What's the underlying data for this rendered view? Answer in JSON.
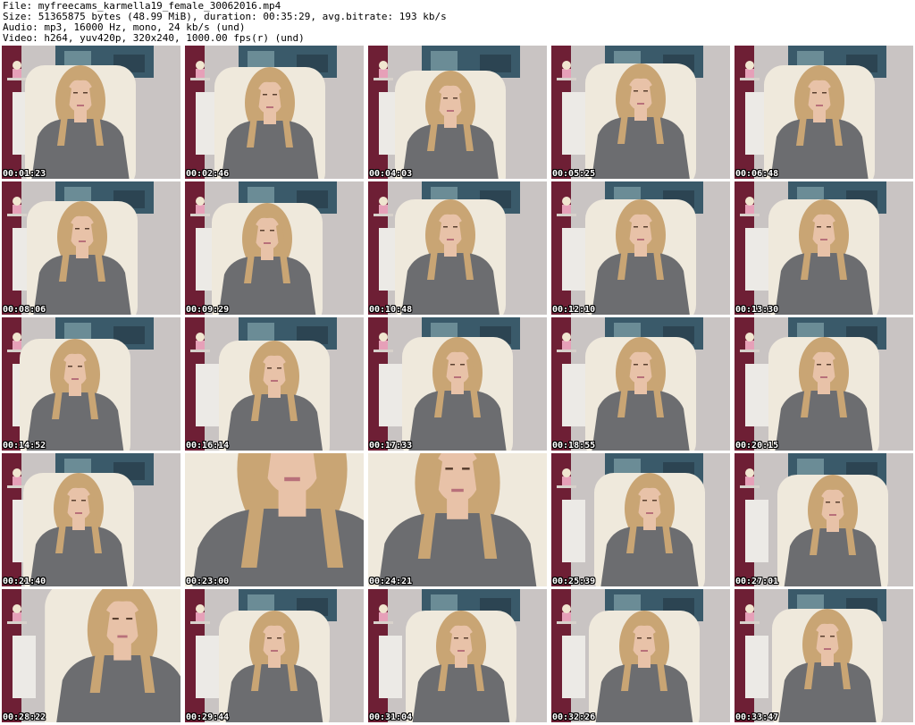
{
  "header": {
    "file_line": "File: myfreecams_karmella19_female_30062016.mp4",
    "size_line": "Size: 51365875 bytes (48.99 MiB), duration: 00:35:29, avg.bitrate: 193 kb/s",
    "audio_line": "Audio: mp3, 16000 Hz, mono, 24 kb/s (und)",
    "video_line": "Video: h264, yuv420p, 320x240, 1000.00 fps(r) (und)"
  },
  "thumbnails": [
    {
      "timestamp": "00:01:23"
    },
    {
      "timestamp": "00:02:46"
    },
    {
      "timestamp": "00:04:03"
    },
    {
      "timestamp": "00:05:25"
    },
    {
      "timestamp": "00:06:48"
    },
    {
      "timestamp": "00:08:06"
    },
    {
      "timestamp": "00:09:29"
    },
    {
      "timestamp": "00:10:48"
    },
    {
      "timestamp": "00:12:10"
    },
    {
      "timestamp": "00:13:30"
    },
    {
      "timestamp": "00:14:52"
    },
    {
      "timestamp": "00:16:14"
    },
    {
      "timestamp": "00:17:33"
    },
    {
      "timestamp": "00:18:55"
    },
    {
      "timestamp": "00:20:15"
    },
    {
      "timestamp": "00:21:40"
    },
    {
      "timestamp": "00:23:00"
    },
    {
      "timestamp": "00:24:21"
    },
    {
      "timestamp": "00:25:39"
    },
    {
      "timestamp": "00:27:01"
    },
    {
      "timestamp": "00:28:22"
    },
    {
      "timestamp": "00:29:44"
    },
    {
      "timestamp": "00:31:04"
    },
    {
      "timestamp": "00:32:26"
    },
    {
      "timestamp": "00:33:47"
    }
  ],
  "colors": {
    "wall": "#c9c4c3",
    "curtain": "#6e1f35",
    "chair": "#efe9dc",
    "shirt": "#6c6d70",
    "hair": "#c9a574",
    "skin": "#e8c2a8",
    "painting": "#3a5a6a",
    "timestamp_text": "#ffffff"
  }
}
